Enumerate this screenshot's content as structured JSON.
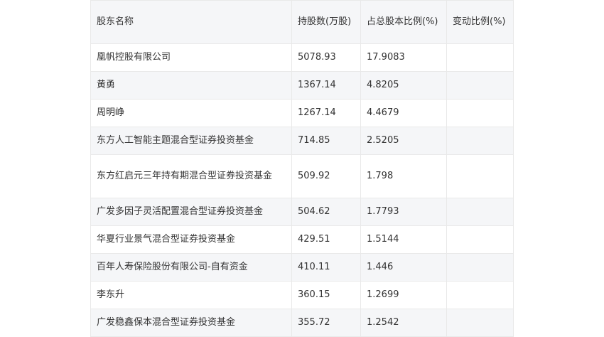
{
  "table": {
    "headers": [
      "股东名称",
      "持股数(万股)",
      "占总股本比例(%)",
      "变动比例(%)"
    ],
    "rows": [
      [
        "凰帆控股有限公司",
        "5078.93",
        "17.9083",
        ""
      ],
      [
        "黄勇",
        "1367.14",
        "4.8205",
        ""
      ],
      [
        "周明峥",
        "1267.14",
        "4.4679",
        ""
      ],
      [
        "东方人工智能主题混合型证券投资基金",
        "714.85",
        "2.5205",
        ""
      ],
      [
        "东方红启元三年持有期混合型证券投资基金",
        "509.92",
        "1.798",
        ""
      ],
      [
        "广发多因子灵活配置混合型证券投资基金",
        "504.62",
        "1.7793",
        ""
      ],
      [
        "华夏行业景气混合型证券投资基金",
        "429.51",
        "1.5144",
        ""
      ],
      [
        "百年人寿保险股份有限公司-自有资金",
        "410.11",
        "1.446",
        ""
      ],
      [
        "李东升",
        "360.15",
        "1.2699",
        ""
      ],
      [
        "广发稳鑫保本混合型证券投资基金",
        "355.72",
        "1.2542",
        ""
      ]
    ]
  }
}
